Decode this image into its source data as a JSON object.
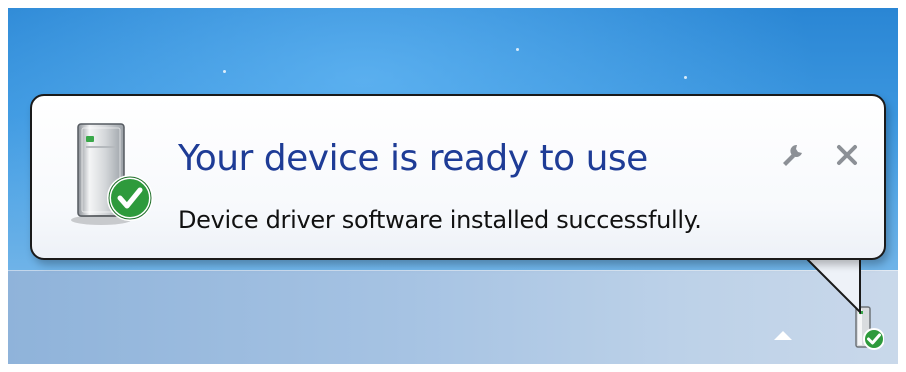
{
  "balloon": {
    "title": "Your device is ready to use",
    "message": "Device driver software installed successfully.",
    "icon": "device-installed-icon",
    "options_icon": "wrench-icon",
    "close_icon": "close-icon"
  },
  "taskbar": {
    "tray": [
      {
        "icon": "show-hidden-icons-arrow-icon"
      },
      {
        "icon": "device-installed-tray-icon"
      }
    ]
  },
  "colors": {
    "title": "#1e3c96",
    "message": "#111111",
    "check_badge": "#2e9a3c",
    "desktop": "#3b96df",
    "taskbar": "#a6c3e3"
  }
}
